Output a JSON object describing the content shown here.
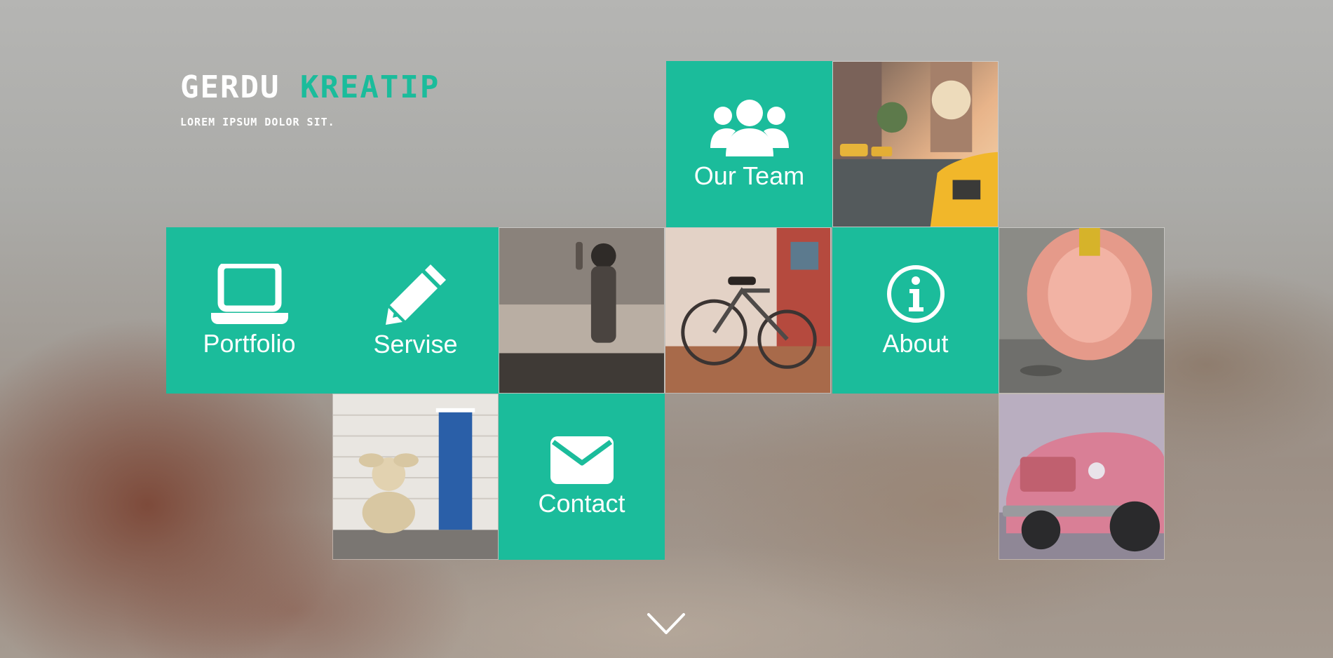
{
  "brand": {
    "title_main": "GERDU",
    "title_accent": "KREATIP",
    "tagline": "LOREM IPSUM DOLOR SIT."
  },
  "colors": {
    "accent": "#1bbc9b",
    "text": "#ffffff"
  },
  "tiles": {
    "our_team": {
      "label": "Our Team",
      "icon": "users-icon"
    },
    "portfolio": {
      "label": "Portfolio",
      "icon": "laptop-icon"
    },
    "servise": {
      "label": "Servise",
      "icon": "pencil-icon"
    },
    "about": {
      "label": "About",
      "icon": "info-circle-icon"
    },
    "contact": {
      "label": "Contact",
      "icon": "envelope-icon"
    }
  },
  "photos": [
    {
      "name": "photo-taxi-street"
    },
    {
      "name": "photo-child-wall"
    },
    {
      "name": "photo-bicycle"
    },
    {
      "name": "photo-lion-dance"
    },
    {
      "name": "photo-bunny-door"
    },
    {
      "name": "photo-pink-truck"
    }
  ],
  "scroll_indicator": {
    "icon": "chevron-down-icon"
  }
}
